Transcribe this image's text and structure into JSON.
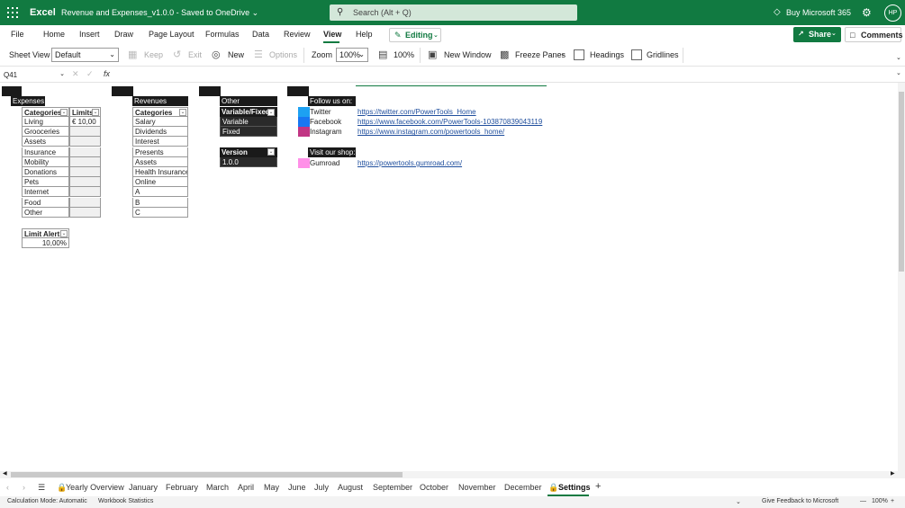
{
  "topbar": {
    "app_name": "Excel",
    "doc_title": "Revenue and Expenses_v1.0.0  -  Saved to OneDrive ⌄",
    "search_placeholder": "Search (Alt + Q)",
    "buy": "Buy Microsoft 365",
    "avatar": "HP",
    "accent": "#117a41"
  },
  "menu": {
    "items": [
      "File",
      "Home",
      "Insert",
      "Draw",
      "Page Layout",
      "Formulas",
      "Data",
      "Review",
      "View",
      "Help"
    ],
    "active": "View",
    "editing": "Editing",
    "share": "Share",
    "comments": "Comments"
  },
  "ribbon": {
    "sheet_view_label": "Sheet View",
    "sheet_view_value": "Default",
    "keep": "Keep",
    "exit": "Exit",
    "new": "New",
    "options": "Options",
    "zoom_label": "Zoom",
    "zoom_value": "100%",
    "zoom_100": "100%",
    "new_window": "New Window",
    "freeze_panes": "Freeze Panes",
    "headings": "Headings",
    "gridlines": "Gridlines"
  },
  "formula_bar": {
    "name_box": "Q41",
    "fx": "fx"
  },
  "sheet": {
    "expenses": {
      "title": "Expenses",
      "col1": "Categories",
      "col2": "Limits",
      "rows": [
        "Living",
        "Grooceries",
        "Assets",
        "Insurance",
        "Mobility",
        "Donations",
        "Pets",
        "Internet",
        "Food",
        "Other"
      ],
      "first_limit": "€  10,00"
    },
    "limit_alert": {
      "header": "Limit Alert",
      "value": "10,00%"
    },
    "revenues": {
      "title": "Revenues",
      "col1": "Categories",
      "rows": [
        "Salary",
        "Dividends",
        "Interest",
        "Presents",
        "Assets",
        "Health Insurance",
        "Online",
        "A",
        "B",
        "C"
      ]
    },
    "other": {
      "title": "Other",
      "col1": "Variable/Fixed",
      "rows": [
        "Variable",
        "Fixed"
      ],
      "version_header": "Version",
      "version_value": "1.0.0"
    },
    "follow": {
      "title": "Follow us on:",
      "items": [
        {
          "name": "Twitter",
          "url": "https://twitter.com/PowerTools_Home",
          "color": "#1da1f2"
        },
        {
          "name": "Facebook",
          "url": "https://www.facebook.com/PowerTools-103870839043119",
          "color": "#1877f2"
        },
        {
          "name": "Instagram",
          "url": "https://www.instagram.com/powertools_home/",
          "color": "#c13584"
        }
      ]
    },
    "shop": {
      "title": "Visit our shop:",
      "items": [
        {
          "name": "Gumroad",
          "url": "https://powertools.gumroad.com/",
          "color": "#ff90e8"
        }
      ]
    }
  },
  "tabs": {
    "items": [
      "Yearly Overview",
      "January",
      "February",
      "March",
      "April",
      "May",
      "June",
      "July",
      "August",
      "September",
      "October",
      "November",
      "December",
      "Settings"
    ],
    "active": "Settings",
    "add": "+"
  },
  "status": {
    "calc_mode": "Calculation Mode: Automatic",
    "stats": "Workbook Statistics",
    "feedback": "Give Feedback to Microsoft",
    "zoom": "100%",
    "minus": "—",
    "plus": "+"
  }
}
